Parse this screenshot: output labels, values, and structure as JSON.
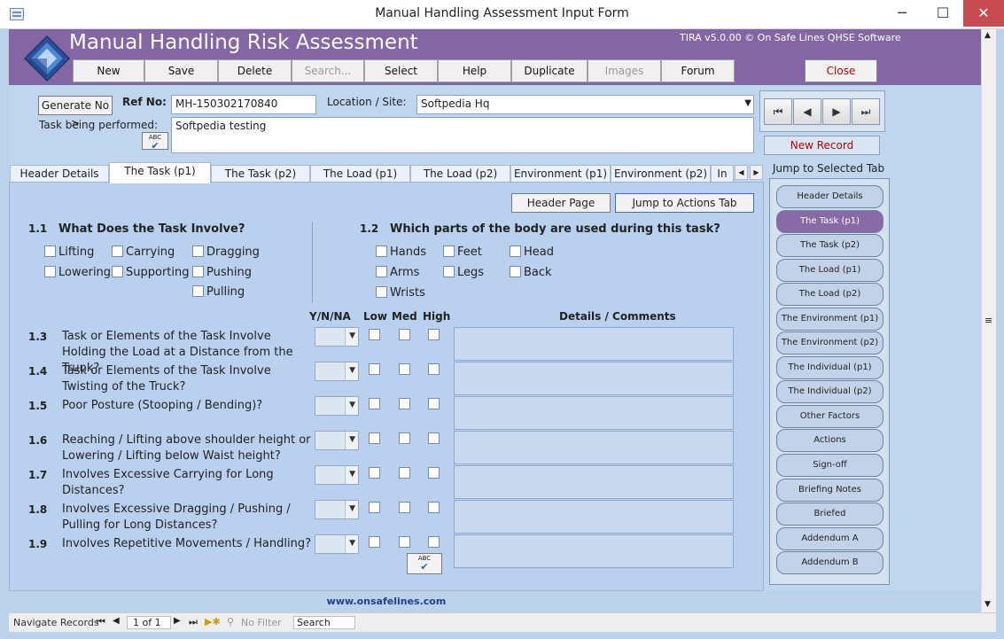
{
  "window": {
    "title": "Manual Handling Assessment Input Form",
    "minimize": "─",
    "maximize": "☐",
    "close": "✕"
  },
  "header": {
    "title": "Manual Handling Risk Assessment",
    "version": "TIRA v5.0.00 © On Safe Lines QHSE Software",
    "toolbar": [
      "New",
      "Save",
      "Delete",
      "Search...",
      "Select",
      "Help",
      "Duplicate",
      "Images",
      "Forum"
    ],
    "close_label": "Close"
  },
  "form": {
    "generate_label": "Generate No >",
    "ref_label": "Ref No:",
    "ref_value": "MH-150302170840",
    "location_label": "Location / Site:",
    "location_value": "Softpedia Hq",
    "task_label": "Task being performed:",
    "task_value": "Softpedia testing",
    "spell_icon_text": "ABC"
  },
  "record_nav": {
    "first": "⏮",
    "prev": "◀",
    "next": "▶",
    "last": "⏭",
    "new_record": "New Record"
  },
  "tabs": [
    "Header Details",
    "The Task (p1)",
    "The Task (p2)",
    "The Load (p1)",
    "The Load (p2)",
    "Environment (p1)",
    "Environment (p2)",
    "In"
  ],
  "tab_scroll": {
    "left": "◀",
    "right": "▶"
  },
  "panel": {
    "header_page_button": "Header Page",
    "jump_actions_button": "Jump to Actions Tab",
    "q11": {
      "num": "1.1",
      "text": "What Does the Task Involve?"
    },
    "q11_options": [
      [
        "Lifting",
        "Carrying",
        "Dragging"
      ],
      [
        "Lowering",
        "Supporting",
        "Pushing"
      ],
      [
        "Pulling"
      ]
    ],
    "q12": {
      "num": "1.2",
      "text": "Which parts of the body are used during this task?"
    },
    "q12_options": [
      [
        "Hands",
        "Feet",
        "Head"
      ],
      [
        "Arms",
        "Legs",
        "Back"
      ],
      [
        "Wrists"
      ]
    ],
    "columns": {
      "ynna": "Y/N/NA",
      "low": "Low",
      "med": "Med",
      "high": "High",
      "details": "Details / Comments"
    },
    "questions": [
      {
        "num": "1.3",
        "text": "Task or Elements of the Task Involve Holding the Load at a Distance from the Trunk?"
      },
      {
        "num": "1.4",
        "text": "Task or Elements of the Task Involve Twisting of the Truck?"
      },
      {
        "num": "1.5",
        "text": "Poor Posture (Stooping / Bending)?"
      },
      {
        "num": "1.6",
        "text": "Reaching / Lifting above shoulder height or Lowering / Lifting below Waist height?"
      },
      {
        "num": "1.7",
        "text": "Involves Excessive Carrying for Long Distances?"
      },
      {
        "num": "1.8",
        "text": "Involves Excessive Dragging / Pushing / Pulling for Long Distances?"
      },
      {
        "num": "1.9",
        "text": "Involves Repetitive Movements / Handling?"
      }
    ],
    "footer_link": "www.onsafelines.com"
  },
  "jump_panel": {
    "title": "Jump to Selected Tab",
    "items": [
      "Header Details",
      "The Task (p1)",
      "The Task (p2)",
      "The Load (p1)",
      "The Load (p2)",
      "The Environment (p1)",
      "The Environment (p2)",
      "The Individual (p1)",
      "The Individual (p2)",
      "Other Factors",
      "Actions",
      "Sign-off",
      "Briefing Notes",
      "Briefed",
      "Addendum A",
      "Addendum B"
    ],
    "active_index": 1
  },
  "statusbar": {
    "navigate_label": "Navigate Records",
    "record_value": "1 of 1",
    "filter_label": "No Filter",
    "search_label": "Search"
  },
  "colors": {
    "header": "#8366a3",
    "form": "#c0d6ef",
    "close_red": "#c00000"
  }
}
